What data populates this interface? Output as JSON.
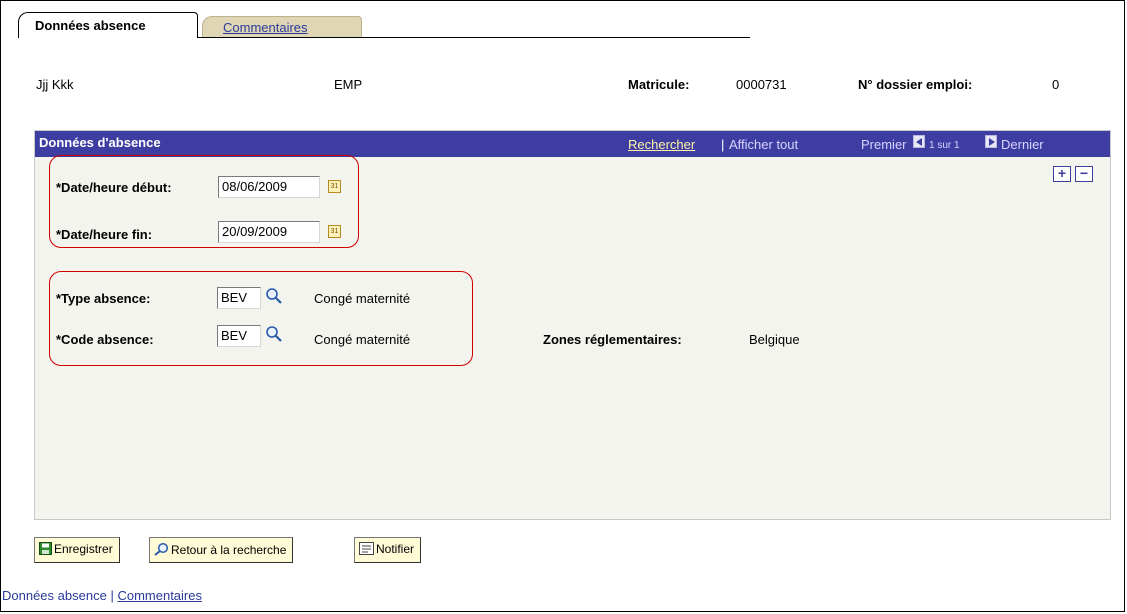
{
  "tabs": {
    "active": "Données absence",
    "inactive": "Commentaires"
  },
  "header": {
    "employee_name": "Jjj Kkk",
    "employee_type": "EMP",
    "matricule_label": "Matricule:",
    "matricule_value": "0000731",
    "dossier_label": "N° dossier emploi:",
    "dossier_value": "0"
  },
  "panel": {
    "title": "Données d'absence",
    "rechercher": "Rechercher",
    "separator": "|",
    "afficher_tout": "Afficher tout",
    "premier": "Premier",
    "page_current": "1",
    "page_sur": "sur",
    "page_total": "1",
    "dernier": "Dernier"
  },
  "fields": {
    "date_debut_label": "*Date/heure début:",
    "date_debut_value": "08/06/2009",
    "date_fin_label": "*Date/heure fin:",
    "date_fin_value": "20/09/2009",
    "type_label": "*Type absence:",
    "type_value": "BEV",
    "type_desc": "Congé maternité",
    "code_label": "*Code absence:",
    "code_value": "BEV",
    "code_desc": "Congé maternité",
    "zones_label": "Zones réglementaires:",
    "zones_value": "Belgique"
  },
  "buttons": {
    "save": "Enregistrer",
    "back": "Retour à la recherche",
    "notify": "Notifier"
  },
  "footer": {
    "link1": "Données absence",
    "separator": "|",
    "link2": "Commentaires"
  },
  "colors": {
    "panel_bar": "#3e3ea2",
    "highlight": "#d00000",
    "button_bg": "#fffbd6",
    "tab_inactive": "#ded6b5"
  }
}
